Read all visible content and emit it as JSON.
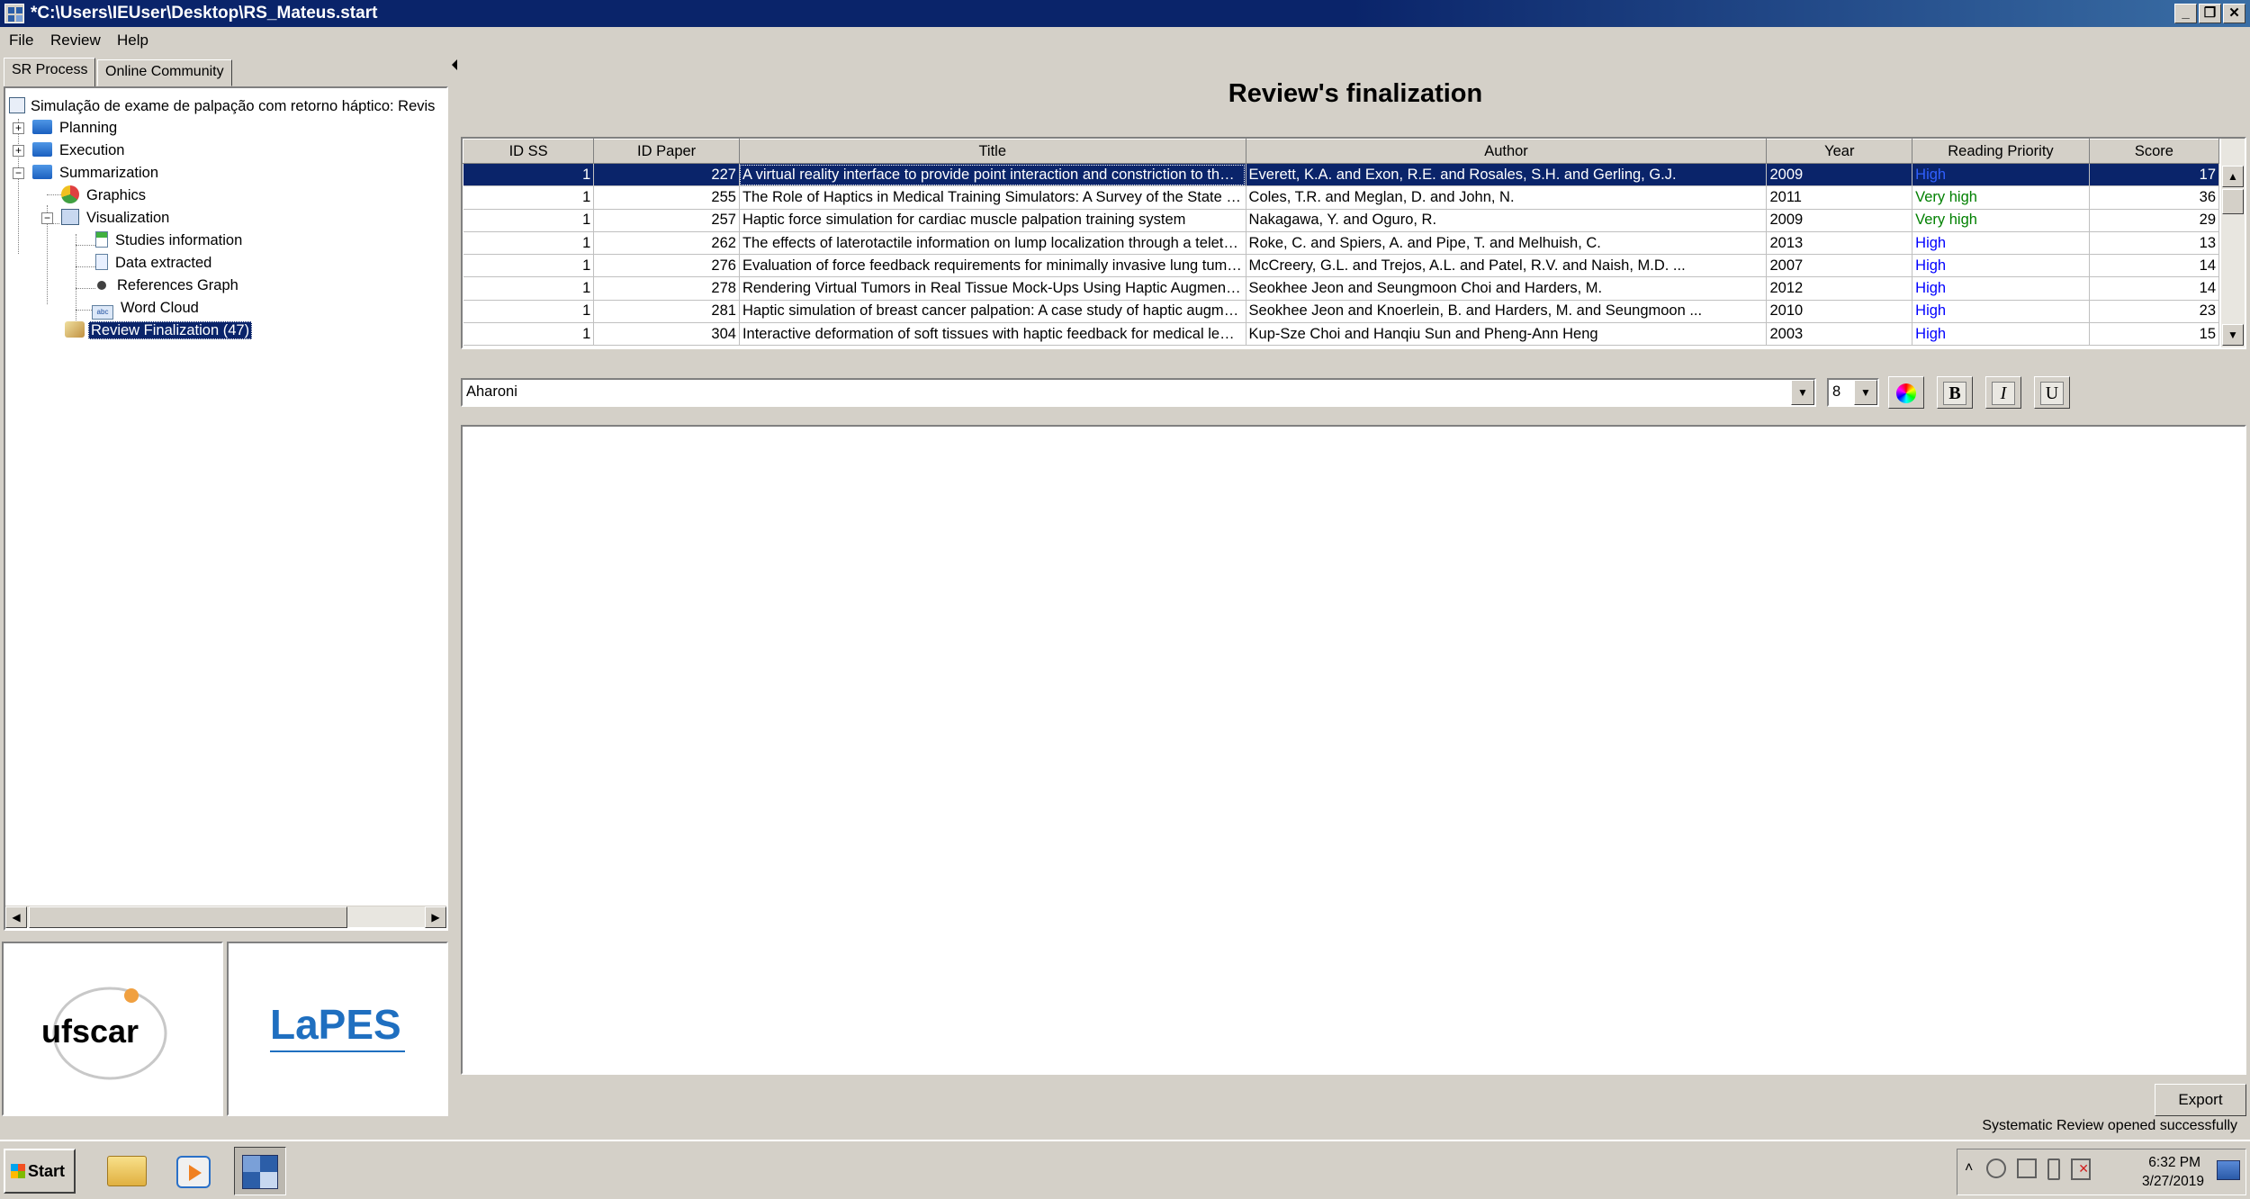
{
  "window": {
    "title": "*C:\\Users\\IEUser\\Desktop\\RS_Mateus.start",
    "buttons": {
      "minimize": "_",
      "maximize": "❐",
      "close": "✕"
    }
  },
  "menu": {
    "file": "File",
    "review": "Review",
    "help": "Help"
  },
  "left_tabs": {
    "sr_process": "SR Process",
    "online_community": "Online Community"
  },
  "tree": {
    "root": "Simulação de exame de palpação com retorno háptico: Revis",
    "planning": "Planning",
    "execution": "Execution",
    "summarization": "Summarization",
    "graphics": "Graphics",
    "visualization": "Visualization",
    "studies_information": "Studies information",
    "data_extracted": "Data extracted",
    "references_graph": "References Graph",
    "word_cloud": "Word Cloud",
    "review_finalization": "Review Finalization (47)"
  },
  "logos": {
    "ufscar": "ufscar",
    "lapes": "LaPES"
  },
  "main": {
    "title": "Review's finalization"
  },
  "table": {
    "columns": [
      "ID SS",
      "ID Paper",
      "Title",
      "Author",
      "Year",
      "Reading Priority",
      "Score"
    ],
    "rows": [
      {
        "id_ss": "1",
        "id_paper": "227",
        "title": "A virtual reality interface to provide point interaction and constriction to the finger",
        "author": "Everett, K.A. and Exon, R.E. and Rosales, S.H. and Gerling, G.J.",
        "year": "2009",
        "priority": "High",
        "score": "17"
      },
      {
        "id_ss": "1",
        "id_paper": "255",
        "title": "The Role of Haptics in Medical Training Simulators: A Survey of the State of the Art",
        "author": "Coles, T.R. and Meglan, D. and John, N.",
        "year": "2011",
        "priority": "Very high",
        "score": "36"
      },
      {
        "id_ss": "1",
        "id_paper": "257",
        "title": "Haptic force simulation for cardiac muscle palpation training system",
        "author": "Nakagawa, Y. and Oguro, R.",
        "year": "2009",
        "priority": "Very high",
        "score": "29"
      },
      {
        "id_ss": "1",
        "id_paper": "262",
        "title": "The effects of laterotactile information on lump localization through a teletaction system",
        "author": "Roke, C. and Spiers, A. and Pipe, T. and Melhuish, C.",
        "year": "2013",
        "priority": "High",
        "score": "13"
      },
      {
        "id_ss": "1",
        "id_paper": "276",
        "title": "Evaluation of force feedback requirements for minimally invasive lung tumour localization",
        "author": "McCreery, G.L. and Trejos, A.L. and Patel, R.V. and Naish, M.D. ...",
        "year": "2007",
        "priority": "High",
        "score": "14"
      },
      {
        "id_ss": "1",
        "id_paper": "278",
        "title": "Rendering Virtual Tumors in Real Tissue Mock-Ups Using Haptic Augmented Reality",
        "author": "Seokhee Jeon and Seungmoon Choi and Harders, M.",
        "year": "2012",
        "priority": "High",
        "score": "14"
      },
      {
        "id_ss": "1",
        "id_paper": "281",
        "title": "Haptic simulation of breast cancer palpation: A case study of haptic augmented reality",
        "author": "Seokhee Jeon and Knoerlein, B. and Harders, M. and Seungmoon ...",
        "year": "2010",
        "priority": "High",
        "score": "23"
      },
      {
        "id_ss": "1",
        "id_paper": "304",
        "title": "Interactive deformation of soft tissues with haptic feedback for medical learning",
        "author": "Kup-Sze Choi and Hanqiu Sun and Pheng-Ann Heng",
        "year": "2003",
        "priority": "High",
        "score": "15"
      }
    ]
  },
  "editor": {
    "font": "Aharoni",
    "size": "8",
    "bold": "B",
    "italic": "I",
    "underline": "U"
  },
  "export_label": "Export",
  "status": "Systematic Review opened successfully",
  "taskbar": {
    "start": "Start",
    "time": "6:32 PM",
    "date": "3/27/2019"
  }
}
